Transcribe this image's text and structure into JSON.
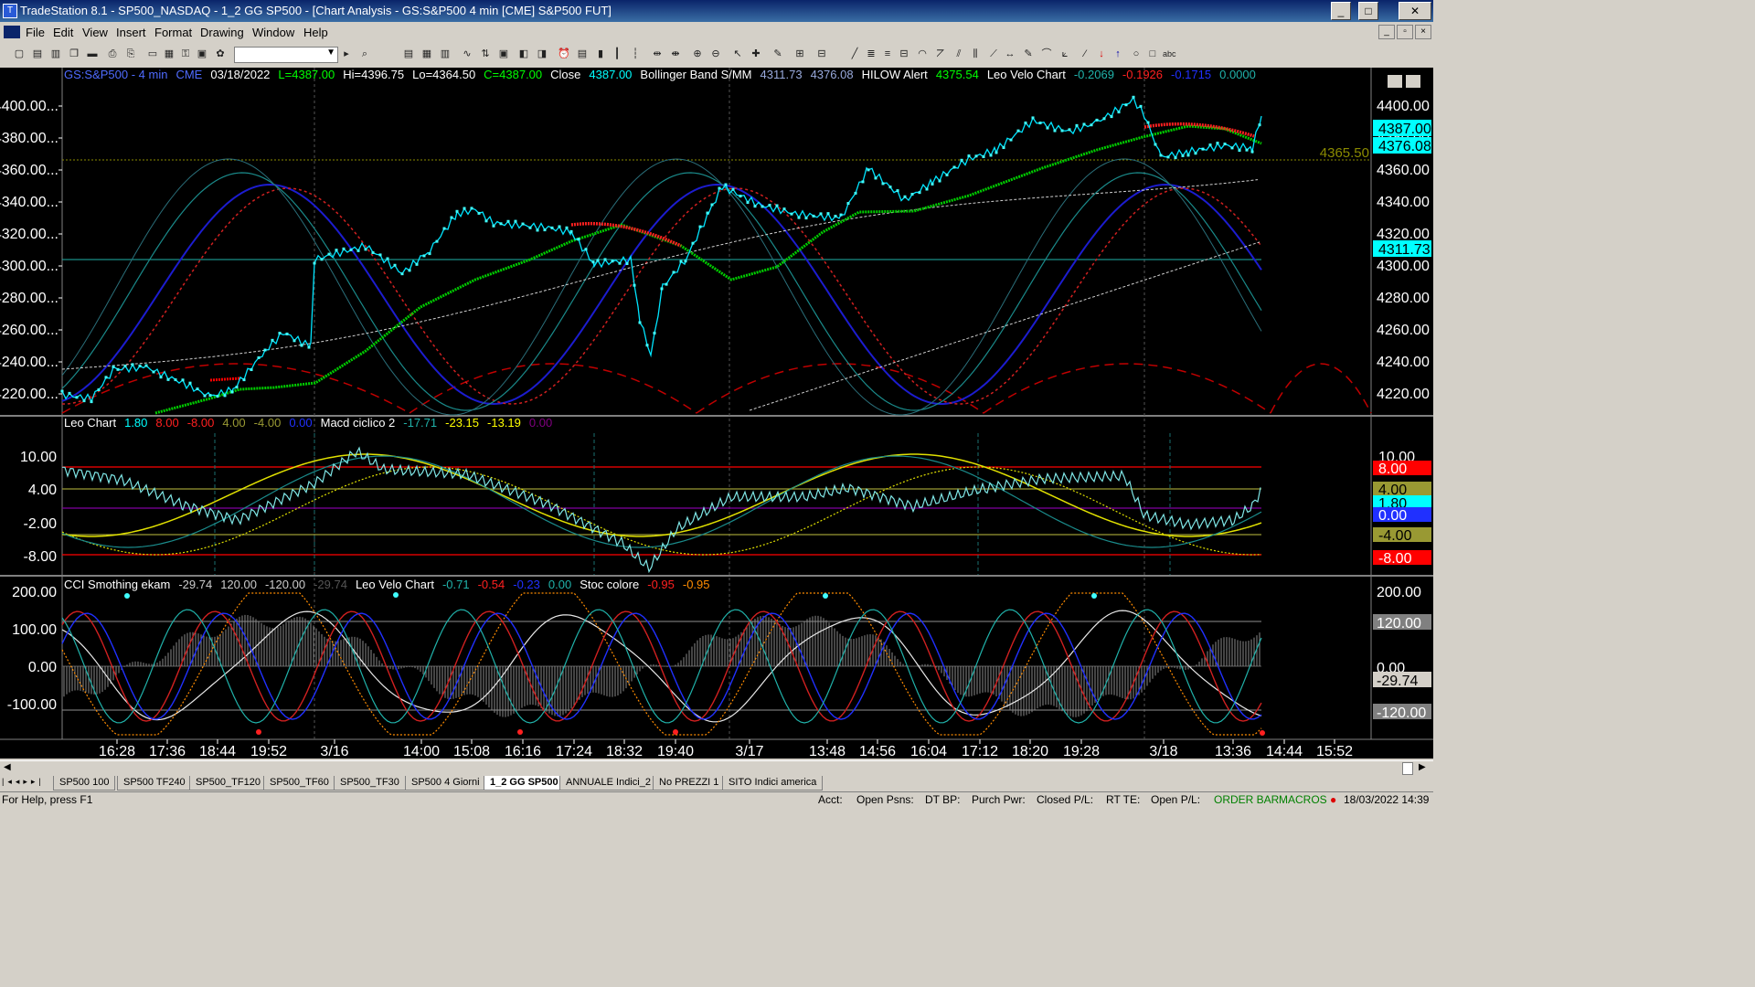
{
  "window": {
    "title": "TradeStation 8.1 - SP500_NASDAQ - 1_2 GG SP500 - [Chart Analysis - GS:S&P500  4 min  [CME] S&P500 FUT]"
  },
  "menu": [
    "File",
    "Edit",
    "View",
    "Insert",
    "Format",
    "Drawing",
    "Window",
    "Help"
  ],
  "chart": {
    "header": [
      {
        "t": "GS:S&P500 - 4 min",
        "c": "#4f6bff"
      },
      {
        "t": "CME",
        "c": "#4f6bff"
      },
      {
        "t": "03/18/2022",
        "c": "#ffffff"
      },
      {
        "t": "L=4387.00",
        "c": "#00ff00"
      },
      {
        "t": "Hi=4396.75",
        "c": "#ffffff"
      },
      {
        "t": "Lo=4364.50",
        "c": "#ffffff"
      },
      {
        "t": "C=4387.00",
        "c": "#00ff00"
      },
      {
        "t": "Close",
        "c": "#ffffff"
      },
      {
        "t": "4387.00",
        "c": "#00ffff"
      },
      {
        "t": "Bollinger Band S/MM",
        "c": "#ffffff"
      },
      {
        "t": "4311.73",
        "c": "#9ad"
      },
      {
        "t": "4376.08",
        "c": "#9ad"
      },
      {
        "t": "HILOW Alert",
        "c": "#ffffff"
      },
      {
        "t": "4375.54",
        "c": "#00ff00"
      },
      {
        "t": "Leo Velo Chart",
        "c": "#ffffff"
      },
      {
        "t": "-0.2069",
        "c": "#20b2aa"
      },
      {
        "t": "-0.1926",
        "c": "#ff2020"
      },
      {
        "t": "-0.1715",
        "c": "#2030ff"
      },
      {
        "t": "0.0000",
        "c": "#20b2aa"
      }
    ],
    "price_axis": [
      "4400.00",
      "4380.00",
      "4360.00",
      "4340.00",
      "4320.00",
      "4300.00",
      "4280.00",
      "4260.00",
      "4240.00",
      "4220.00"
    ],
    "price_tags": [
      {
        "t": "4400.00",
        "bg": "#000",
        "fg": "#fff"
      },
      {
        "t": "4387.00",
        "bg": "#00ffff",
        "fg": "#000"
      },
      {
        "t": "4376.08",
        "bg": "#00ffff",
        "fg": "#000"
      },
      {
        "t": "4311.73",
        "bg": "#00ffff",
        "fg": "#000"
      }
    ],
    "level_label": "4365.50",
    "panel2_header": [
      {
        "t": "Leo Chart",
        "c": "#ffffff"
      },
      {
        "t": "1.80",
        "c": "#00ffff"
      },
      {
        "t": "8.00",
        "c": "#ff2020"
      },
      {
        "t": "-8.00",
        "c": "#ff2020"
      },
      {
        "t": "4.00",
        "c": "#999933"
      },
      {
        "t": "-4.00",
        "c": "#999933"
      },
      {
        "t": "0.00",
        "c": "#2030ff"
      },
      {
        "t": "Macd ciclico 2",
        "c": "#ffffff"
      },
      {
        "t": "-17.71",
        "c": "#20b2aa"
      },
      {
        "t": "-23.15",
        "c": "#ffff00"
      },
      {
        "t": "-13.19",
        "c": "#ffff00"
      },
      {
        "t": "0.00",
        "c": "#800080"
      }
    ],
    "panel2_axis": [
      "10.00",
      "4.00",
      "-2.00",
      "-8.00"
    ],
    "panel2_tags": [
      {
        "t": "10.00",
        "bg": "#000",
        "fg": "#fff"
      },
      {
        "t": "8.00",
        "bg": "#ff0000",
        "fg": "#fff"
      },
      {
        "t": "4.00",
        "bg": "#999933",
        "fg": "#000"
      },
      {
        "t": "1.80",
        "bg": "#00ffff",
        "fg": "#000"
      },
      {
        "t": "0.00",
        "bg": "#2030ff",
        "fg": "#fff"
      },
      {
        "t": "-4.00",
        "bg": "#999933",
        "fg": "#000"
      },
      {
        "t": "-8.00",
        "bg": "#ff0000",
        "fg": "#fff"
      }
    ],
    "panel3_header": [
      {
        "t": "CCI Smothing ekam",
        "c": "#ffffff"
      },
      {
        "t": "-29.74",
        "c": "#cccccc"
      },
      {
        "t": "120.00",
        "c": "#cccccc"
      },
      {
        "t": "-120.00",
        "c": "#cccccc"
      },
      {
        "t": "-29.74",
        "c": "#555555"
      },
      {
        "t": "Leo Velo Chart",
        "c": "#ffffff"
      },
      {
        "t": "-0.71",
        "c": "#20b2aa"
      },
      {
        "t": "-0.54",
        "c": "#ff2020"
      },
      {
        "t": "-0.23",
        "c": "#2030ff"
      },
      {
        "t": "0.00",
        "c": "#20b2aa"
      },
      {
        "t": "Stoc colore",
        "c": "#ffffff"
      },
      {
        "t": "-0.95",
        "c": "#ff2020"
      },
      {
        "t": "-0.95",
        "c": "#ff8c00"
      }
    ],
    "panel3_axis": [
      "200.00",
      "100.00",
      "0.00",
      "-100.00"
    ],
    "panel3_tags": [
      {
        "t": "200.00",
        "bg": "#000",
        "fg": "#fff"
      },
      {
        "t": "120.00",
        "bg": "#808080",
        "fg": "#fff"
      },
      {
        "t": "0.00",
        "bg": "#000",
        "fg": "#fff"
      },
      {
        "t": "-29.74",
        "bg": "#d4d0c8",
        "fg": "#000"
      },
      {
        "t": "-120.00",
        "bg": "#808080",
        "fg": "#fff"
      }
    ],
    "time_axis": [
      "16:28",
      "17:36",
      "18:44",
      "19:52",
      "3/16",
      "14:00",
      "15:08",
      "16:16",
      "17:24",
      "18:32",
      "19:40",
      "3/17",
      "13:48",
      "14:56",
      "16:04",
      "17:12",
      "18:20",
      "19:28",
      "3/18",
      "13:36",
      "14:44",
      "15:52"
    ]
  },
  "tabs": [
    "SP500 100",
    "SP500 TF240",
    "SP500_TF120",
    "SP500_TF60",
    "SP500_TF30",
    "SP500 4 Giorni",
    "1_2 GG SP500",
    "ANNUALE Indici_2",
    "No PREZZI 1",
    "SITO Indici america"
  ],
  "active_tab": "1_2 GG SP500",
  "status": {
    "help": "For Help, press F1",
    "acct": "Acct:",
    "open_psns": "Open Psns:",
    "dt_bp": "DT BP:",
    "purch_pwr": "Purch Pwr:",
    "closed_pl": "Closed P/L:",
    "rt_te": "RT TE:",
    "open_pl": "Open P/L:",
    "order_bar": "ORDER BAR",
    "macros": "MACROS",
    "datetime": "18/03/2022 14:39"
  }
}
